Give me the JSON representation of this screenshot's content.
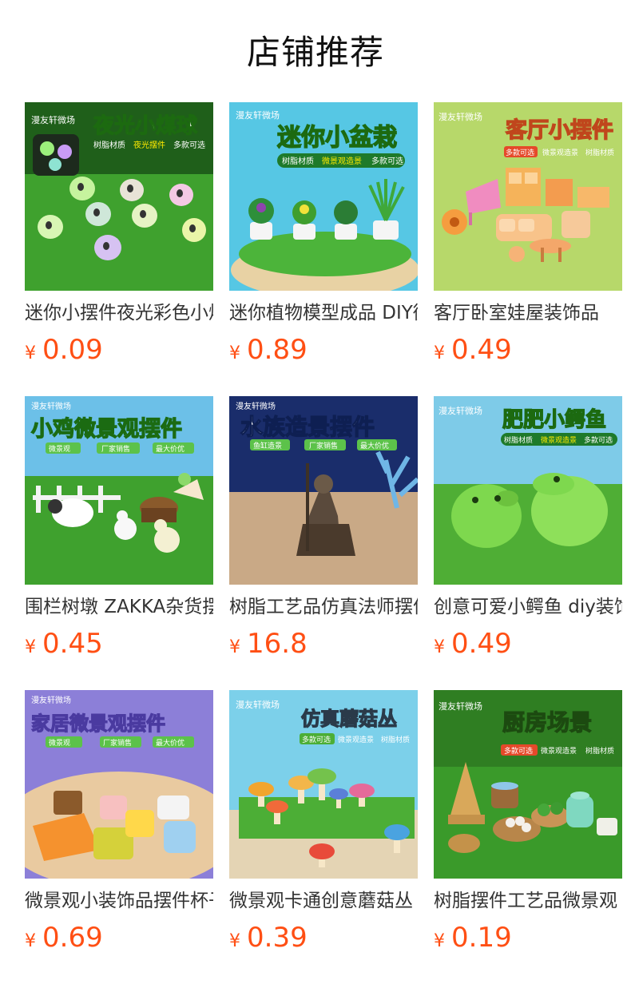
{
  "section_title": "店铺推荐",
  "currency_symbol": "¥",
  "colors": {
    "price": "#ff4f14",
    "title": "#111111",
    "name": "#333333"
  },
  "products": [
    {
      "name": "迷你小摆件夜光彩色小煤球",
      "price": "0.09",
      "banner": "夜光小煤球",
      "brand": "漫友轩微场",
      "tags": [
        "树脂材质",
        "夜光摆件",
        "多款可选"
      ]
    },
    {
      "name": "迷你植物模型成品 DIY微景观",
      "price": "0.89",
      "banner": "迷你小盆栽",
      "brand": "漫友轩微场",
      "tags": [
        "树脂材质",
        "微景观造景",
        "多款可选"
      ]
    },
    {
      "name": "客厅卧室娃屋装饰品",
      "price": "0.49",
      "banner": "客厅小摆件",
      "brand": "漫友轩微场",
      "tags": [
        "多款可选",
        "微景观造景",
        "树脂材质"
      ]
    },
    {
      "name": "围栏树墩 ZAKKA杂货摆件",
      "price": "0.45",
      "banner": "小鸡微景观摆件",
      "brand": "漫友轩微场",
      "tags": [
        "微景观",
        "厂家销售",
        "最大价优"
      ]
    },
    {
      "name": "树脂工艺品仿真法师摆件",
      "price": "16.8",
      "banner": "水族造景摆件",
      "brand": "漫友轩微场",
      "tags": [
        "鱼缸造景",
        "厂家销售",
        "最大价优"
      ]
    },
    {
      "name": "创意可爱小鳄鱼 diy装饰",
      "price": "0.49",
      "banner": "肥肥小鳄鱼",
      "brand": "漫友轩微场",
      "tags": [
        "树脂材质",
        "微景观造景",
        "多款可选"
      ]
    },
    {
      "name": "微景观小装饰品摆件杯子",
      "price": "0.69",
      "banner": "家居微景观摆件",
      "brand": "漫友轩微场",
      "tags": [
        "微景观",
        "厂家销售",
        "最大价优"
      ]
    },
    {
      "name": "微景观卡通创意蘑菇丛",
      "price": "0.39",
      "banner": "仿真蘑菇丛",
      "brand": "漫友轩微场",
      "tags": [
        "多款可选",
        "微景观造景",
        "树脂材质"
      ]
    },
    {
      "name": "树脂摆件工艺品微景观",
      "price": "0.19",
      "banner": "厨房场景",
      "brand": "漫友轩微场",
      "tags": [
        "多款可选",
        "微景观造景",
        "树脂材质"
      ]
    }
  ]
}
